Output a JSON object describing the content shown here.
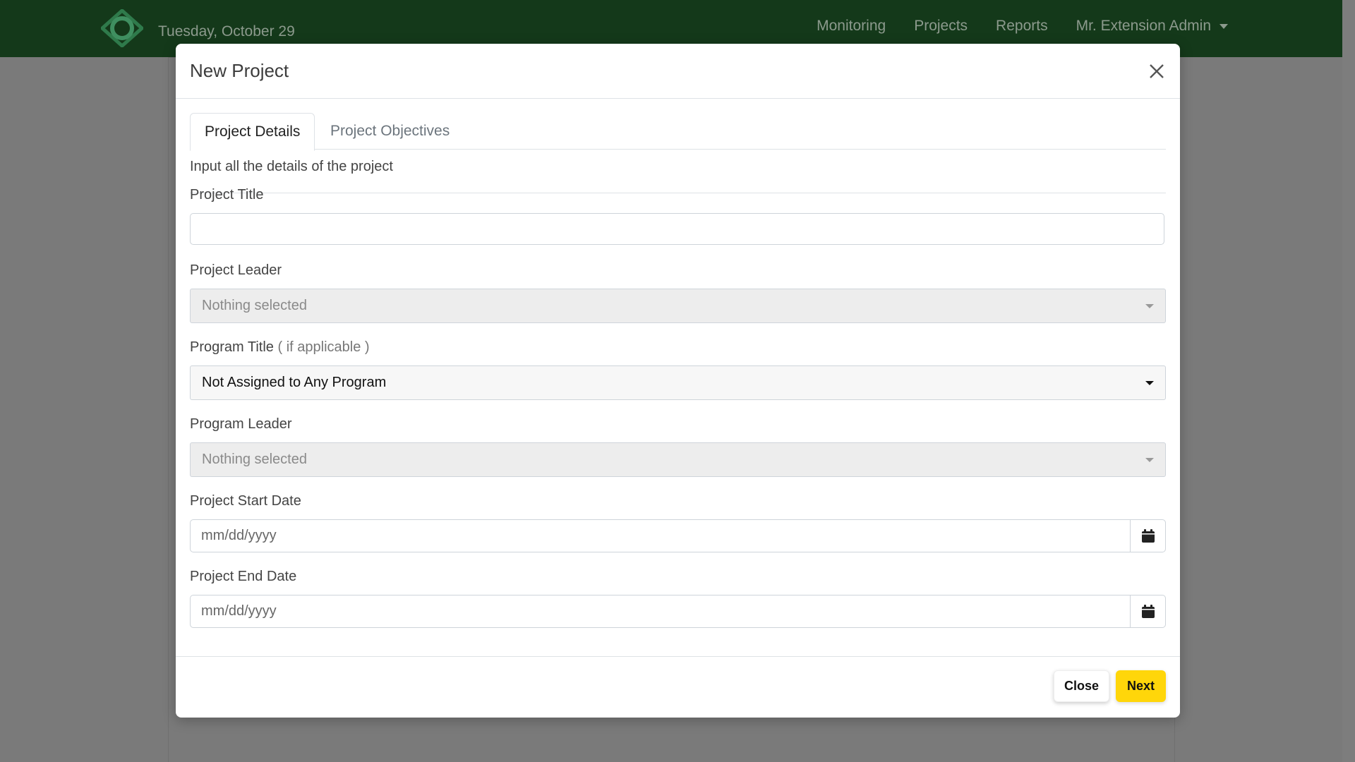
{
  "navbar": {
    "date": "Tuesday, October 29",
    "links": [
      "Monitoring",
      "Projects",
      "Reports"
    ],
    "user_menu": "Mr. Extension Admin",
    "logo_icon": "diamond-ring-logo-icon",
    "colors": {
      "background": "#14391a",
      "text": "#8c9a8d"
    }
  },
  "modal": {
    "title": "New Project",
    "close_icon": "close-icon",
    "tabs": [
      {
        "label": "Project Details",
        "active": true
      },
      {
        "label": "Project Objectives",
        "active": false
      }
    ],
    "intro": "Input all the details of the project",
    "fields": {
      "project_title": {
        "label": "Project Title",
        "value": ""
      },
      "project_leader": {
        "label": "Project Leader",
        "value": "Nothing selected"
      },
      "program_title": {
        "label": "Program Title",
        "label_hint": "( if applicable )",
        "value": "Not Assigned to Any Program"
      },
      "program_leader": {
        "label": "Program Leader",
        "value": "Nothing selected"
      },
      "start_date": {
        "label": "Project Start Date",
        "placeholder": "mm/dd/yyyy"
      },
      "end_date": {
        "label": "Project End Date",
        "placeholder": "mm/dd/yyyy"
      }
    },
    "footer": {
      "close_label": "Close",
      "next_label": "Next",
      "colors": {
        "next": "#ffd60a"
      }
    }
  }
}
